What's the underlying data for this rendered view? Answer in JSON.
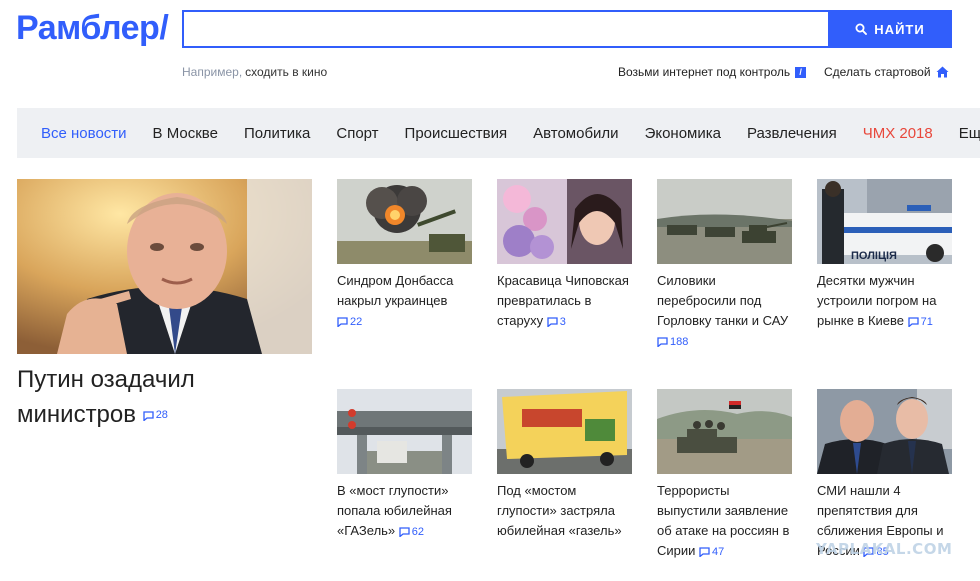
{
  "header": {
    "logo": "Рамблер/",
    "search_placeholder": "",
    "search_button": "НАЙТИ",
    "hint_prefix": "Например,",
    "hint_example": "сходить в кино",
    "util_internet": "Возьми интернет под контроль",
    "util_startpage": "Сделать стартовой"
  },
  "nav": {
    "items": [
      "Все новости",
      "В Москве",
      "Политика",
      "Спорт",
      "Происшествия",
      "Автомобили",
      "Экономика",
      "Развлечения",
      "ЧМХ 2018",
      "Ещё"
    ]
  },
  "main_story": {
    "title": "Путин озадачил министров",
    "comments": "28"
  },
  "cards": [
    {
      "title": "Синдром Донбасса накрыл украинцев",
      "comments": "22"
    },
    {
      "title": "Красавица Чиповская превратилась в старуху",
      "comments": "3"
    },
    {
      "title": "Силовики перебросили под Горловку танки и САУ",
      "comments": "188"
    },
    {
      "title": "Десятки мужчин устроили погром на рынке в Киеве",
      "comments": "71"
    },
    {
      "title": "В «мост глупости» попала юбилейная «ГАЗель»",
      "comments": "62"
    },
    {
      "title": "Под «мостом глупости» застряла юбилейная «газель»",
      "comments": ""
    },
    {
      "title": "Террористы выпустили заявление об атаке на россиян в Сирии",
      "comments": "47"
    },
    {
      "title": "СМИ нашли 4 препятствия для сближения Европы и России",
      "comments": "85"
    }
  ],
  "police_label": "ПОЛІЦІЯ",
  "watermark": "YAPLAKAL.COM",
  "colors": {
    "accent": "#315efb",
    "nav_bg": "#eef0f3",
    "highlight": "#e8473b"
  }
}
